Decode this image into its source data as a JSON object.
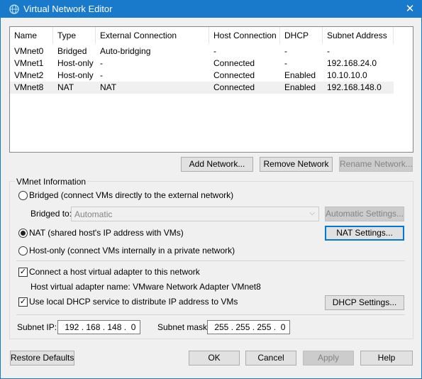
{
  "window": {
    "title": "Virtual Network Editor",
    "close_glyph": "✕",
    "icon": "network-globe-icon"
  },
  "table": {
    "columns": [
      "Name",
      "Type",
      "External Connection",
      "Host Connection",
      "DHCP",
      "Subnet Address"
    ],
    "rows": [
      [
        "VMnet0",
        "Bridged",
        "Auto-bridging",
        "-",
        "-",
        "-"
      ],
      [
        "VMnet1",
        "Host-only",
        "-",
        "Connected",
        "-",
        "192.168.24.0"
      ],
      [
        "VMnet2",
        "Host-only",
        "-",
        "Connected",
        "Enabled",
        "10.10.10.0"
      ],
      [
        "VMnet8",
        "NAT",
        "NAT",
        "Connected",
        "Enabled",
        "192.168.148.0"
      ]
    ],
    "selected_row": "VMnet8"
  },
  "list_buttons": {
    "add": "Add Network...",
    "remove": "Remove Network",
    "rename": "Rename Network..."
  },
  "vmnet_info": {
    "legend": "VMnet Information",
    "bridged_label": "Bridged (connect VMs directly to the external network)",
    "bridged_to_label": "Bridged to:",
    "bridged_to_value": "Automatic",
    "auto_settings": "Automatic Settings...",
    "nat_label": "NAT (shared host's IP address with VMs)",
    "nat_settings": "NAT Settings...",
    "hostonly_label": "Host-only (connect VMs internally in a private network)",
    "selected_mode": "NAT",
    "connect_adapter_label": "Connect a host virtual adapter to this network",
    "connect_adapter_checked": true,
    "adapter_name_label": "Host virtual adapter name: VMware Network Adapter VMnet8",
    "dhcp_label": "Use local DHCP service to distribute IP address to VMs",
    "dhcp_checked": true,
    "dhcp_settings": "DHCP Settings...",
    "subnet_ip_label": "Subnet IP:",
    "subnet_ip": " 192 . 168 . 148 .  0",
    "subnet_mask_label": "Subnet mask:",
    "subnet_mask": " 255 . 255 . 255 .  0",
    "check_glyph": "✓"
  },
  "footer": {
    "restore": "Restore Defaults",
    "ok": "OK",
    "cancel": "Cancel",
    "apply": "Apply",
    "help": "Help"
  },
  "colors": {
    "titlebar": "#1979ca",
    "selection": "#f0f0f0",
    "focus_border": "#0078d7"
  }
}
